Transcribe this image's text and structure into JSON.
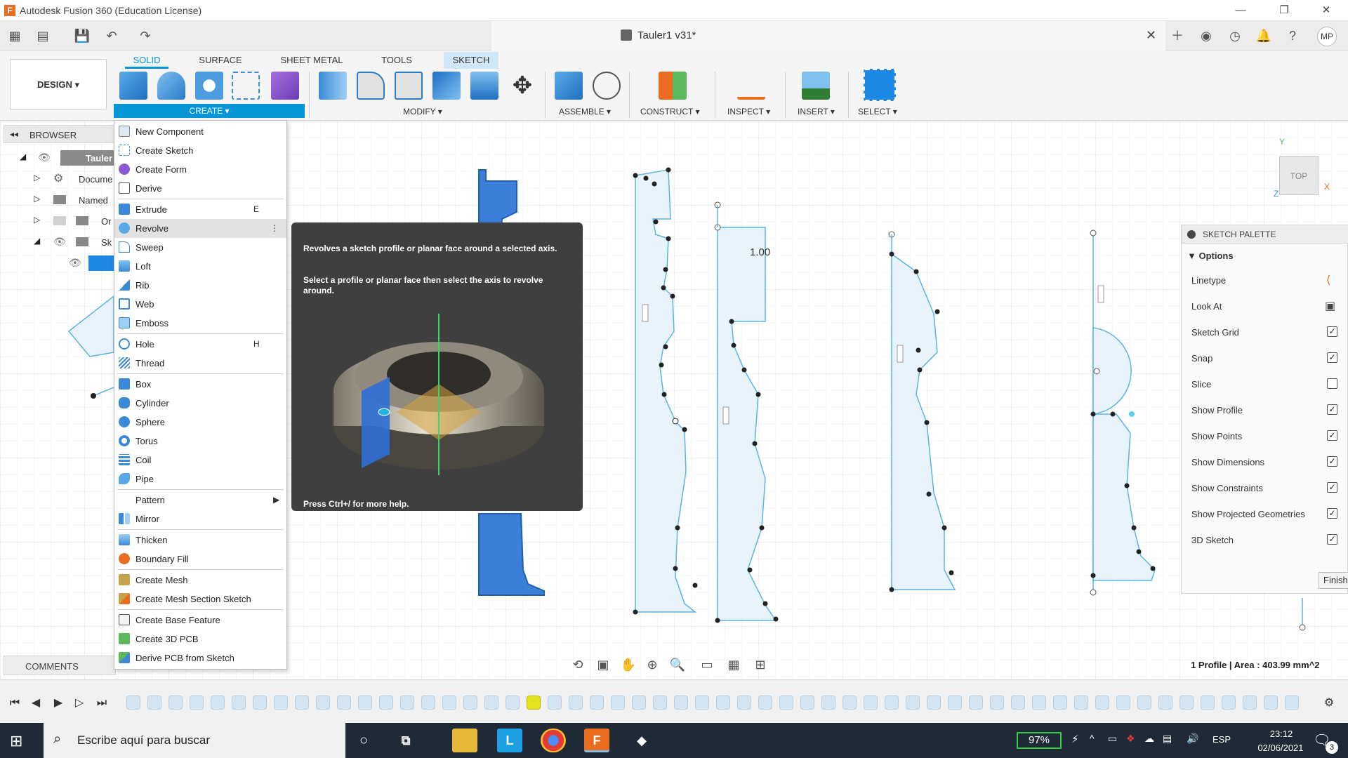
{
  "window": {
    "title": "Autodesk Fusion 360 (Education License)",
    "logo_letter": "F"
  },
  "document": {
    "title": "Tauler1 v31*",
    "user_initials": "MP"
  },
  "ribbon": {
    "workspace": "DESIGN ▾",
    "tabs": [
      "SOLID",
      "SURFACE",
      "SHEET METAL",
      "TOOLS",
      "SKETCH"
    ],
    "groups": [
      "CREATE ▾",
      "MODIFY ▾",
      "ASSEMBLE ▾",
      "CONSTRUCT ▾",
      "INSPECT ▾",
      "INSERT ▾",
      "SELECT ▾"
    ]
  },
  "browser": {
    "title": "BROWSER",
    "rows": [
      "Tauler",
      "Docume",
      "Named",
      "Or",
      "Sk"
    ],
    "comments": "COMMENTS"
  },
  "create_menu": {
    "items": [
      {
        "label": "New Component",
        "shortcut": ""
      },
      {
        "label": "Create Sketch",
        "shortcut": ""
      },
      {
        "label": "Create Form",
        "shortcut": ""
      },
      {
        "label": "Derive",
        "shortcut": ""
      },
      {
        "label": "Extrude",
        "shortcut": "E"
      },
      {
        "label": "Revolve",
        "shortcut": "⋮"
      },
      {
        "label": "Sweep",
        "shortcut": ""
      },
      {
        "label": "Loft",
        "shortcut": ""
      },
      {
        "label": "Rib",
        "shortcut": ""
      },
      {
        "label": "Web",
        "shortcut": ""
      },
      {
        "label": "Emboss",
        "shortcut": ""
      },
      {
        "label": "Hole",
        "shortcut": "H"
      },
      {
        "label": "Thread",
        "shortcut": ""
      },
      {
        "label": "Box",
        "shortcut": ""
      },
      {
        "label": "Cylinder",
        "shortcut": ""
      },
      {
        "label": "Sphere",
        "shortcut": ""
      },
      {
        "label": "Torus",
        "shortcut": ""
      },
      {
        "label": "Coil",
        "shortcut": ""
      },
      {
        "label": "Pipe",
        "shortcut": ""
      },
      {
        "label": "Pattern",
        "shortcut": "▶"
      },
      {
        "label": "Mirror",
        "shortcut": ""
      },
      {
        "label": "Thicken",
        "shortcut": ""
      },
      {
        "label": "Boundary Fill",
        "shortcut": ""
      },
      {
        "label": "Create Mesh",
        "shortcut": ""
      },
      {
        "label": "Create Mesh Section Sketch",
        "shortcut": ""
      },
      {
        "label": "Create Base Feature",
        "shortcut": ""
      },
      {
        "label": "Create 3D PCB",
        "shortcut": ""
      },
      {
        "label": "Derive PCB from Sketch",
        "shortcut": ""
      }
    ]
  },
  "tooltip": {
    "line1": "Revolves a sketch profile or planar face around a selected axis.",
    "line2": "Select a profile or planar face then select the axis to revolve around.",
    "help": "Press Ctrl+/ for more help."
  },
  "canvas": {
    "dimension_label": "1.00",
    "viewcube_face": "TOP",
    "axis_y": "Y",
    "axis_x": "X",
    "axis_z": "Z"
  },
  "sketch_palette": {
    "title": "SKETCH PALETTE",
    "section": "Options",
    "rows": [
      {
        "label": "Linetype",
        "check": "icon"
      },
      {
        "label": "Look At",
        "check": "icon"
      },
      {
        "label": "Sketch Grid",
        "check": "✓"
      },
      {
        "label": "Snap",
        "check": "✓"
      },
      {
        "label": "Slice",
        "check": ""
      },
      {
        "label": "Show Profile",
        "check": "✓"
      },
      {
        "label": "Show Points",
        "check": "✓"
      },
      {
        "label": "Show Dimensions",
        "check": "✓"
      },
      {
        "label": "Show Constraints",
        "check": "✓"
      },
      {
        "label": "Show Projected Geometries",
        "check": "✓"
      },
      {
        "label": "3D Sketch",
        "check": "✓"
      }
    ],
    "finish": "Finish"
  },
  "status": {
    "profile": "1 Profile | Area : 403.99 mm^2"
  },
  "taskbar": {
    "search_placeholder": "Escribe aquí para buscar",
    "battery": "97%",
    "language": "ESP",
    "time": "23:12",
    "date": "02/06/2021",
    "notifications": "3"
  },
  "colors": {
    "accent": "#0696d7",
    "sketch_line": "#5bb4e5",
    "solid_blue": "#3b7fd9",
    "tooltip_bg": "#3f3f3f",
    "taskbar": "#1f2a36"
  }
}
